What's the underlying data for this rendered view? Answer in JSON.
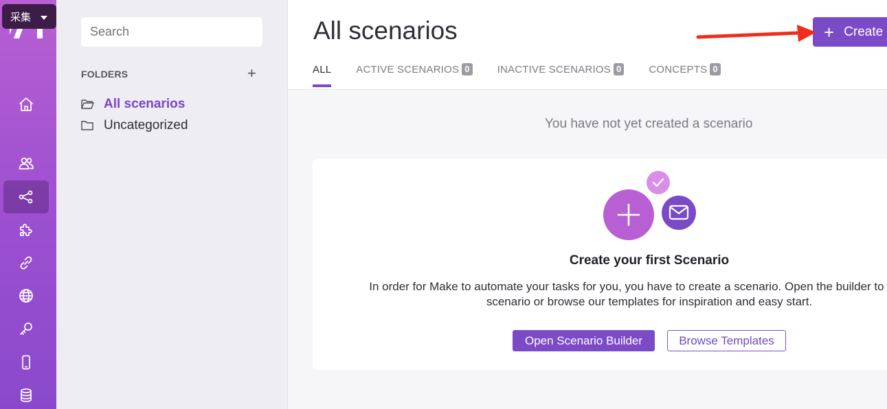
{
  "overlay": {
    "label": "采集"
  },
  "search": {
    "placeholder": "Search"
  },
  "folders": {
    "title": "FOLDERS",
    "add_label": "+",
    "items": [
      {
        "label": "All scenarios",
        "active": true
      },
      {
        "label": "Uncategorized",
        "active": false
      }
    ]
  },
  "header": {
    "title": "All scenarios",
    "create_label": "Create",
    "tabs": [
      {
        "label": "ALL",
        "count": null,
        "active": true
      },
      {
        "label": "ACTIVE SCENARIOS",
        "count": "0",
        "active": false
      },
      {
        "label": "INACTIVE SCENARIOS",
        "count": "0",
        "active": false
      },
      {
        "label": "CONCEPTS",
        "count": "0",
        "active": false
      }
    ]
  },
  "main": {
    "empty_message": "You have not yet created a scenario",
    "card": {
      "title": "Create your first Scenario",
      "text_line1": "In order for Make to automate your tasks for you, you have to create a scenario. Open the builder to create a",
      "text_line2": "scenario or browse our templates for inspiration and easy start.",
      "primary_label": "Open Scenario Builder",
      "secondary_label": "Browse Templates"
    }
  },
  "colors": {
    "accent": "#7b4ac7",
    "rail_top": "#b85fd3",
    "rail_bottom": "#8a49cc",
    "annotation_arrow": "#f02c1c"
  },
  "icons": [
    "home-icon",
    "team-icon",
    "scenarios-icon",
    "apps-icon",
    "connections-icon",
    "webhooks-icon",
    "keys-icon",
    "devices-icon",
    "data-stores-icon"
  ]
}
